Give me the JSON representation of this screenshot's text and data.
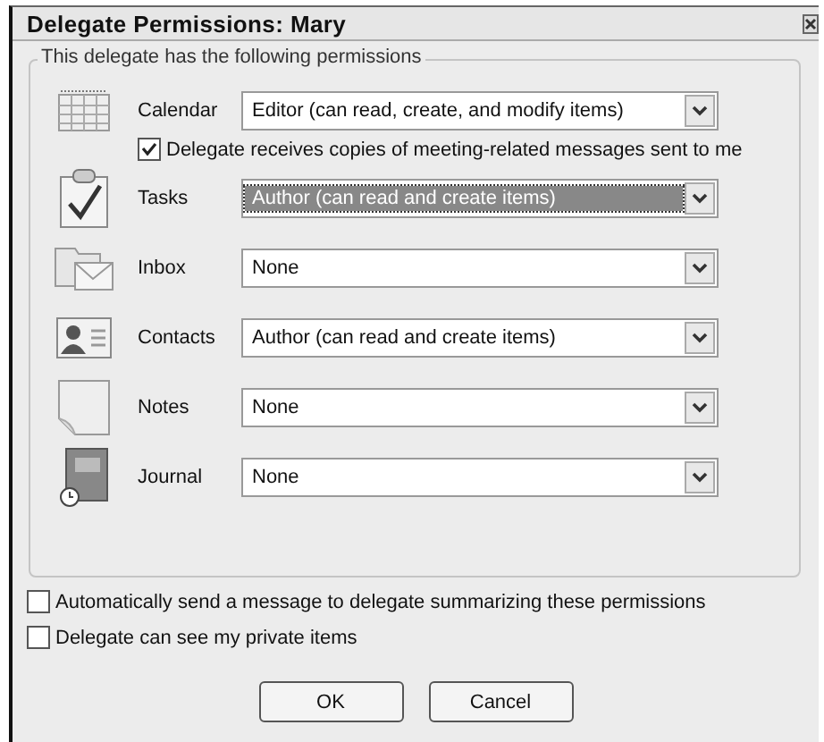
{
  "window": {
    "title": "Delegate Permissions: Mary"
  },
  "group": {
    "title": "This delegate has the following permissions"
  },
  "folders": [
    {
      "kind": "calendar",
      "label": "Calendar",
      "value": "Editor (can read, create, and modify items)",
      "focused": false,
      "option": {
        "label": "Delegate receives copies of meeting-related messages sent to me",
        "checked": true
      }
    },
    {
      "kind": "tasks",
      "label": "Tasks",
      "value": "Author (can read and create items)",
      "focused": true
    },
    {
      "kind": "inbox",
      "label": "Inbox",
      "value": "None",
      "focused": false
    },
    {
      "kind": "contacts",
      "label": "Contacts",
      "value": "Author (can read and create items)",
      "focused": false
    },
    {
      "kind": "notes",
      "label": "Notes",
      "value": "None",
      "focused": false
    },
    {
      "kind": "journal",
      "label": "Journal",
      "value": "None",
      "focused": false
    }
  ],
  "options": [
    {
      "label": "Automatically send a message to delegate summarizing these permissions",
      "checked": false
    },
    {
      "label": "Delegate can see my private items",
      "checked": false
    }
  ],
  "buttons": [
    "OK",
    "Cancel"
  ]
}
